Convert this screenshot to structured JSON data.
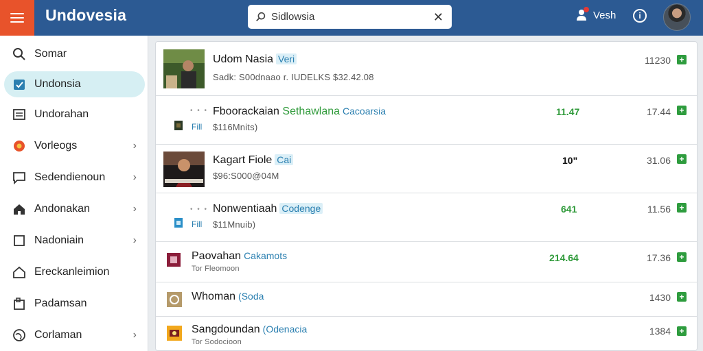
{
  "app": {
    "title": "Undovesia"
  },
  "search": {
    "value": "Sidlowsia",
    "placeholder": "Search"
  },
  "user": {
    "name": "Vesh"
  },
  "sidebar": {
    "items": [
      {
        "label": "Somar",
        "icon": "search-icon",
        "chevron": false,
        "active": false
      },
      {
        "label": "Undonsia",
        "icon": "calendar-check-icon",
        "chevron": false,
        "active": true
      },
      {
        "label": "Undorahan",
        "icon": "list-icon",
        "chevron": false,
        "active": false
      },
      {
        "label": "Vorleogs",
        "icon": "flower-icon",
        "chevron": true,
        "active": false
      },
      {
        "label": "Sedendienoun",
        "icon": "message-icon",
        "chevron": true,
        "active": false
      },
      {
        "label": "Andonakan",
        "icon": "home-icon",
        "chevron": true,
        "active": false
      },
      {
        "label": "Nadoniain",
        "icon": "square-icon",
        "chevron": true,
        "active": false
      },
      {
        "label": "Ereckanleimion",
        "icon": "house-outline-icon",
        "chevron": false,
        "active": false
      },
      {
        "label": "Padamsan",
        "icon": "document-icon",
        "chevron": false,
        "active": false
      },
      {
        "label": "Corlaman",
        "icon": "globe-icon",
        "chevron": true,
        "active": false
      }
    ]
  },
  "list": {
    "rows": [
      {
        "title": "Udom Nasia",
        "tag": "Veri",
        "sub": "Sadk: S00dnaao r. IUDELKS $32.42.08",
        "mid": "",
        "value": "11230"
      },
      {
        "title": "Fboorackaian",
        "title_green": "Sethawlana",
        "tag": "Cacoarsia",
        "fil": "Fill",
        "sub": "$116Mnits)",
        "mid": "11.47",
        "value": "17.44"
      },
      {
        "title": "Kagart Fiole",
        "tag": "Cai",
        "sub": "$96:S000@04M",
        "mid": "10\"",
        "value": "31.06"
      },
      {
        "title": "Nonwentiaah",
        "tag": "Codenge",
        "fil": "Fill",
        "sub": "$11Mnuib)",
        "mid": "641",
        "value": "11.56"
      },
      {
        "title": "Paovahan",
        "tag": "Cakamots",
        "sub": "Tor Fleomoon",
        "mid": "214.64",
        "value": "17.36"
      },
      {
        "title": "Whoman",
        "tag": "(Soda",
        "sub": "",
        "mid": "",
        "value": "1430"
      },
      {
        "title": "Sangdoundan",
        "tag": "(Odenacia",
        "sub": "Tor Sodocioon",
        "mid": "",
        "value": "1384"
      }
    ]
  },
  "colors": {
    "topbar": "#2c5a93",
    "menu_button": "#e8532b",
    "active_nav": "#d6eff3",
    "accent_green": "#2f9a3a",
    "accent_blue": "#2a7fb0"
  }
}
